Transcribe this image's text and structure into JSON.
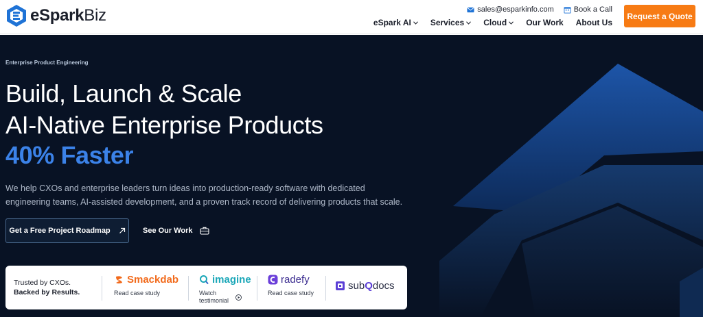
{
  "header": {
    "logo_brand": "eSpark",
    "logo_suffix": "Biz",
    "email": "sales@esparkinfo.com",
    "book_call": "Book a Call",
    "nav": [
      {
        "label": "eSpark AI",
        "dropdown": true
      },
      {
        "label": "Services",
        "dropdown": true
      },
      {
        "label": "Cloud",
        "dropdown": true
      },
      {
        "label": "Our Work",
        "dropdown": false
      },
      {
        "label": "About Us",
        "dropdown": false
      }
    ],
    "quote_button": "Request a Quote"
  },
  "hero": {
    "eyebrow": "Enterprise Product Engineering",
    "title_line1": "Build, Launch & Scale",
    "title_line2": "AI-Native Enterprise Products",
    "title_line3": "40% Faster",
    "description": "We help CXOs and enterprise leaders turn ideas into production-ready software with dedicated engineering teams, AI-assisted development, and a proven track record of delivering products that scale.",
    "cta_primary": "Get a Free Project Roadmap",
    "cta_secondary": "See Our Work"
  },
  "trust": {
    "line1": "Trusted by CXOs.",
    "line2": "Backed by Results.",
    "brands": [
      {
        "name": "Smackdab",
        "link": "Read case study",
        "color": "#f26a1b"
      },
      {
        "name": "imagine",
        "link_line1": "Watch",
        "link_line2": "testimonial",
        "color": "#1aa7b8"
      },
      {
        "name": "radefy",
        "link": "Read case study",
        "color": "#3a2b8f"
      },
      {
        "name_part1": "sub",
        "name_part2": "Q",
        "name_part3": "docs",
        "color": "#5b3fd6"
      }
    ]
  },
  "colors": {
    "accent_orange": "#f77b14",
    "hero_bg": "#081224",
    "highlight_blue": "#3b82e8"
  },
  "icons": [
    "logo-mark-icon",
    "mail-icon",
    "calendar-icon",
    "chevron-down-icon",
    "arrow-up-right-icon",
    "briefcase-icon",
    "play-icon"
  ]
}
